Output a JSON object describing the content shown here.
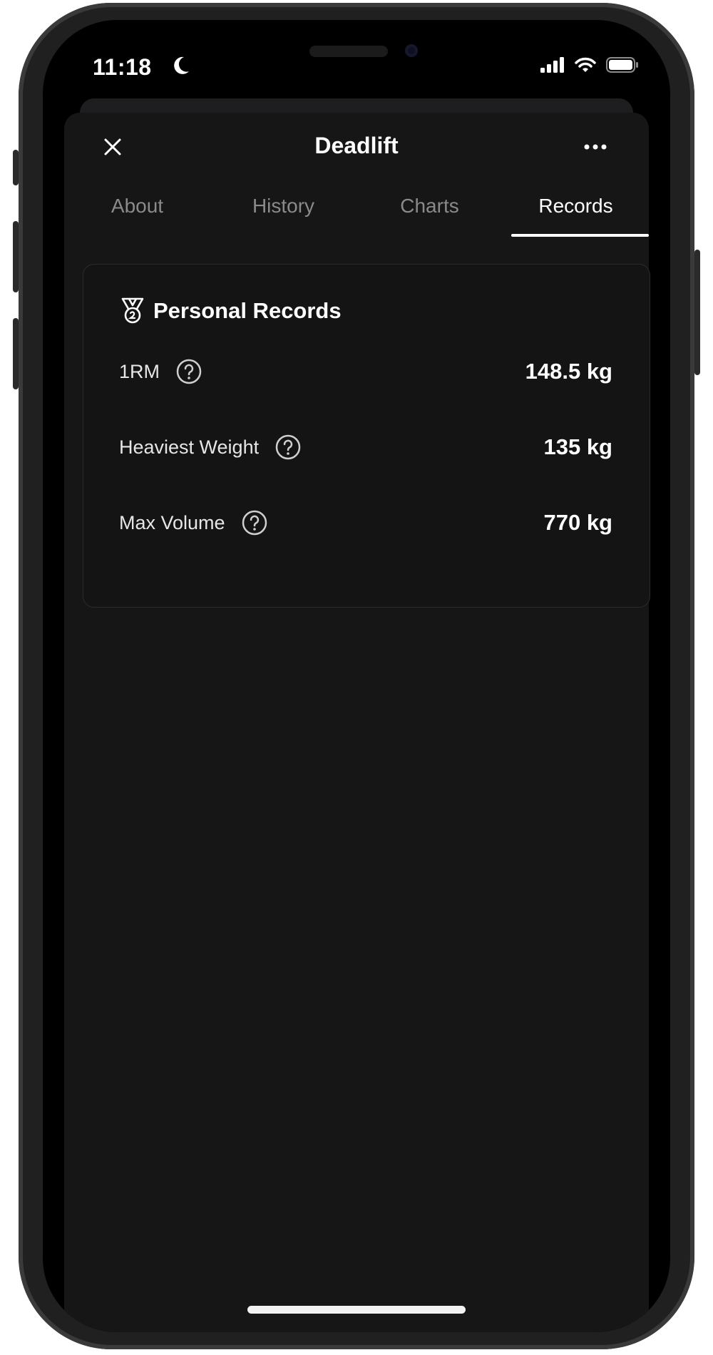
{
  "status_bar": {
    "time": "11:18"
  },
  "header": {
    "title": "Deadlift"
  },
  "tabs": [
    {
      "label": "About",
      "active": false
    },
    {
      "label": "History",
      "active": false
    },
    {
      "label": "Charts",
      "active": false
    },
    {
      "label": "Records",
      "active": true
    }
  ],
  "records_card": {
    "title": "Personal Records",
    "rows": [
      {
        "label": "1RM",
        "value": "148.5 kg"
      },
      {
        "label": "Heaviest Weight",
        "value": "135 kg"
      },
      {
        "label": "Max Volume",
        "value": "770 kg"
      }
    ]
  },
  "colors": {
    "sheet_background": "#161616",
    "text_primary": "#ffffff",
    "tab_inactive": "#8a8a8a",
    "card_border": "#2b2b2b"
  },
  "icons": {
    "close": "close-icon",
    "more": "more-horizontal-icon",
    "medal": "medal-icon",
    "help": "help-circle-icon"
  }
}
